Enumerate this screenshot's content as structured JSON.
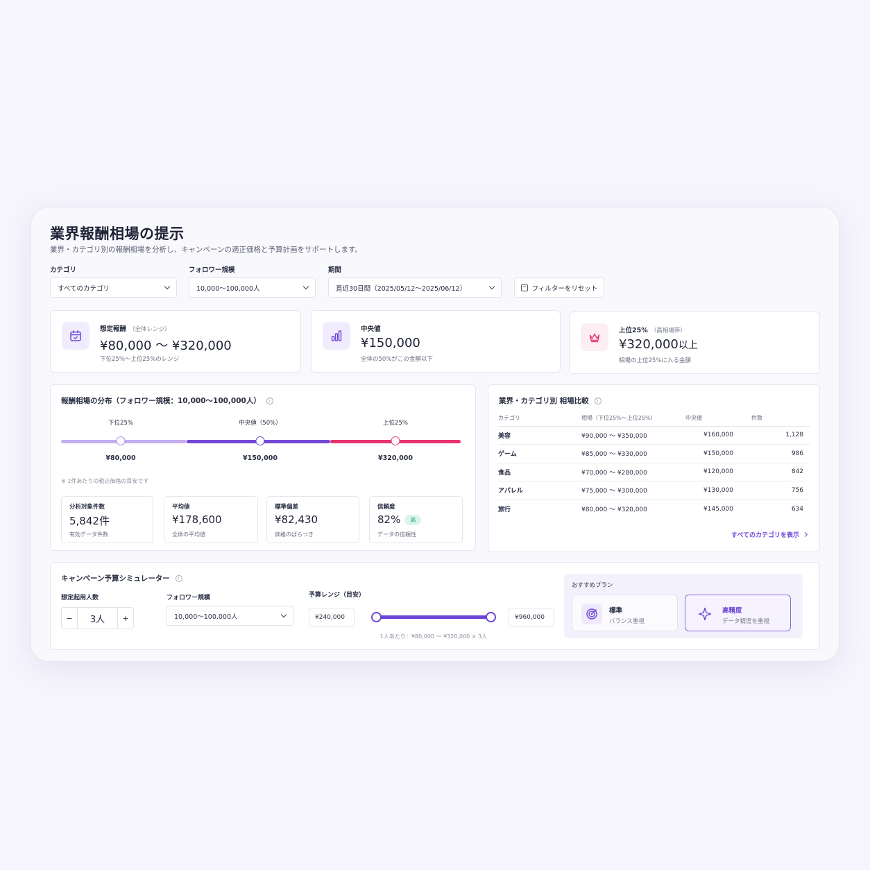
{
  "header": {
    "title": "業界報酬相場の提示",
    "subtitle": "業界・カテゴリ別の報酬相場を分析し、キャンペーンの適正価格と予算計画をサポートします。"
  },
  "filters": {
    "category": {
      "label": "カテゴリ",
      "value": "すべてのカテゴリ"
    },
    "followers": {
      "label": "フォロワー規模",
      "value": "10,000〜100,000人"
    },
    "period": {
      "label": "期間",
      "value": "直近30日間（2025/05/12〜2025/06/12）"
    },
    "reset_label": "フィルターをリセット"
  },
  "kpis": {
    "expected": {
      "label": "想定報酬",
      "sub": "（全体レンジ）",
      "value": "¥80,000 〜 ¥320,000",
      "caption": "下位25%〜上位25%のレンジ",
      "icon": "calendar-icon"
    },
    "median": {
      "label": "中央値",
      "value": "¥150,000",
      "caption": "全体の50%がこの金額以下",
      "icon": "bar-chart-icon"
    },
    "top": {
      "label": "上位25%",
      "sub": "（高相場帯）",
      "value": "¥320,000",
      "suffix": "以上",
      "caption": "相場の上位25%に入る金額",
      "icon": "crown-icon"
    }
  },
  "distribution": {
    "title": "報酬相場の分布（フォロワー規模：10,000〜100,000人）",
    "markers": [
      {
        "label": "下位25%",
        "value": "¥80,000"
      },
      {
        "label": "中央値（50%）",
        "value": "¥150,000"
      },
      {
        "label": "上位25%",
        "value": "¥320,000"
      }
    ],
    "note": "※ 1件あたりの税込価格の目安です",
    "stats": [
      {
        "label": "分析対象件数",
        "value": "5,842件",
        "caption": "有効データ件数"
      },
      {
        "label": "平均値",
        "value": "¥178,600",
        "caption": "全体の平均値"
      },
      {
        "label": "標準偏差",
        "value": "¥82,430",
        "caption": "価格のばらつき"
      },
      {
        "label": "信頼度",
        "value": "82%",
        "badge": "高",
        "caption": "データの信頼性"
      }
    ]
  },
  "comparison": {
    "title": "業界・カテゴリ別 相場比較",
    "columns": [
      "カテゴリ",
      "相場（下位25%〜上位25%）",
      "中央値",
      "件数"
    ],
    "rows": [
      [
        "美容",
        "¥90,000 〜 ¥350,000",
        "¥160,000",
        "1,128"
      ],
      [
        "ゲーム",
        "¥85,000 〜 ¥330,000",
        "¥150,000",
        "986"
      ],
      [
        "食品",
        "¥70,000 〜 ¥280,000",
        "¥120,000",
        "842"
      ],
      [
        "アパレル",
        "¥75,000 〜 ¥300,000",
        "¥130,000",
        "756"
      ],
      [
        "旅行",
        "¥80,000 〜 ¥320,000",
        "¥145,000",
        "634"
      ]
    ],
    "link": "すべてのカテゴリを表示"
  },
  "simulator": {
    "title": "キャンペーン予算シミュレーター",
    "people_label": "想定起用人数",
    "people_value": "3人",
    "minus": "−",
    "plus": "+",
    "followers_label": "フォロワー規模",
    "followers_value": "10,000〜100,000人",
    "budget_label": "予算レンジ（目安）",
    "budget_min": "¥240,000",
    "budget_max": "¥960,000",
    "budget_note": "1人あたり：¥80,000 〜 ¥320,000 × 3人",
    "plans_title": "おすすめプラン",
    "plans": [
      {
        "name": "標準",
        "desc": "バランス重視",
        "icon": "target-icon"
      },
      {
        "name": "高精度",
        "desc": "データ精度を重視",
        "icon": "sparkle-icon"
      }
    ]
  },
  "colors": {
    "accent": "#6b45d6",
    "pink": "#e8336f",
    "light_purple": "#c3aef0",
    "success": "#20a487"
  }
}
